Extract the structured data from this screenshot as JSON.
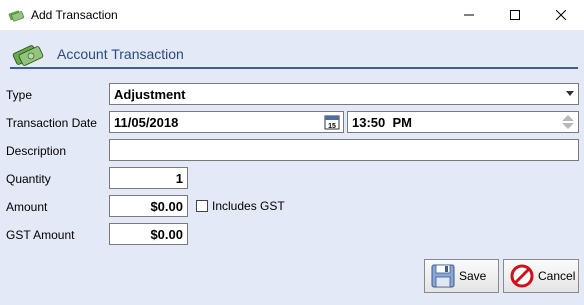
{
  "window": {
    "title": "Add Transaction",
    "icon": "money-icon",
    "controls": [
      "minimize-icon",
      "maximize-icon",
      "close-icon"
    ]
  },
  "section": {
    "title": "Account Transaction",
    "icon": "money-icon"
  },
  "form": {
    "type": {
      "label": "Type",
      "value": "Adjustment"
    },
    "transaction_date": {
      "label": "Transaction Date",
      "date": "11/05/2018",
      "time": "13:50  PM"
    },
    "description": {
      "label": "Description",
      "value": ""
    },
    "quantity": {
      "label": "Quantity",
      "value": "1"
    },
    "amount": {
      "label": "Amount",
      "value": "$0.00"
    },
    "includes_gst": {
      "label": "Includes GST",
      "checked": false
    },
    "gst_amount": {
      "label": "GST Amount",
      "value": "$0.00"
    }
  },
  "buttons": {
    "save": {
      "label": "Save",
      "icon": "floppy-disk-icon"
    },
    "cancel": {
      "label": "Cancel",
      "icon": "cancel-icon"
    }
  },
  "colors": {
    "client_bg": "#e3e9f7",
    "section_title": "#2b4a80",
    "section_rule": "#3e5f93"
  }
}
